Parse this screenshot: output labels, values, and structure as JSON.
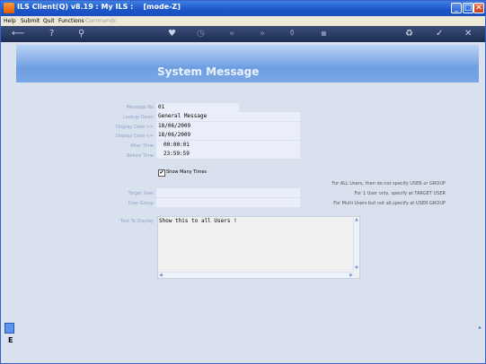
{
  "window": {
    "title": "ILS Client(Q) v8.19 : My ILS :    [mode-Z]",
    "controls": {
      "minimize": "_",
      "maximize": "□",
      "close": "✕"
    }
  },
  "menu": [
    {
      "label": "Help"
    },
    {
      "label": "Submit"
    },
    {
      "label": "Quit"
    },
    {
      "label": "Functions"
    },
    {
      "label": "Commands",
      "disabled": true
    }
  ],
  "toolbar": {
    "icons": [
      "back-arrow-icon",
      "help-icon",
      "search-icon",
      "heart-icon",
      "clock-icon",
      "rewind-icon",
      "forward-icon",
      "filter-icon",
      "save-icon",
      "refresh-icon",
      "check-icon",
      "cancel-icon"
    ],
    "glyphs": [
      "⟵",
      "?",
      "⚲",
      "♥",
      "◷",
      "«",
      "»",
      "⚱",
      "▪",
      "♻",
      "✓",
      "✕"
    ]
  },
  "banner": {
    "title": "System Message"
  },
  "form": {
    "message_no": {
      "label": "Message No",
      "value": "01"
    },
    "lookup_descr": {
      "label": "Lookup Descr",
      "value": "General Message"
    },
    "display_date_from": {
      "label": "Display Date >=",
      "value": "18/06/2009"
    },
    "display_date_to": {
      "label": "Display Date <=",
      "value": "18/06/2009"
    },
    "after_time": {
      "label": "After Time",
      "value": "00:00:01"
    },
    "before_time": {
      "label": "Before Time",
      "value": "23:59:59"
    },
    "show_many_times": {
      "label": "Show Many Times",
      "checked": true,
      "mark": "✔"
    },
    "target_user": {
      "label": "Target User",
      "value": ""
    },
    "user_group": {
      "label": "User Group",
      "value": ""
    },
    "text_to_display": {
      "label": "Text To Display",
      "value": "Show this to all Users !"
    }
  },
  "hints": [
    "For ALL Users, then do not specify USER or GROUP",
    "For 1 User only, specify at TARGET USER",
    "For Multi Users but not all,specify at USER GROUP"
  ]
}
